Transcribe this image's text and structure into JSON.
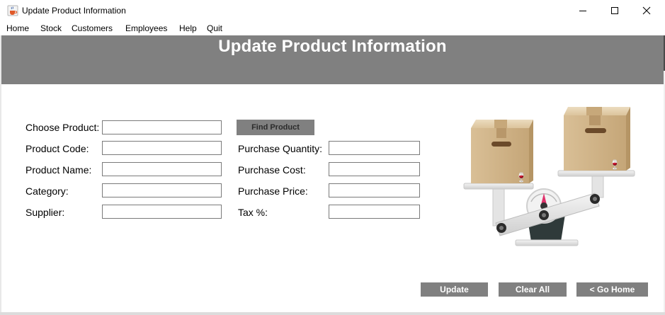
{
  "window": {
    "title": "Update Product Information",
    "controls": {
      "minimize": "minimize",
      "maximize": "maximize",
      "close": "close"
    }
  },
  "menu": {
    "items": [
      "Home",
      "Stock",
      "Customers",
      "Employees",
      "Help",
      "Quit"
    ]
  },
  "header": {
    "title": "Update Product Information"
  },
  "form": {
    "left": [
      {
        "label": "Choose Product:",
        "value": ""
      },
      {
        "label": "Product Code:",
        "value": ""
      },
      {
        "label": "Product Name:",
        "value": ""
      },
      {
        "label": "Category:",
        "value": ""
      },
      {
        "label": "Supplier:",
        "value": ""
      }
    ],
    "right": [
      {
        "label": "Purchase Quantity:",
        "value": ""
      },
      {
        "label": "Purchase Cost:",
        "value": ""
      },
      {
        "label": "Purchase Price:",
        "value": ""
      },
      {
        "label": "Tax %:",
        "value": ""
      }
    ],
    "find_button": "Find Product"
  },
  "actions": {
    "update": "Update",
    "clear_all": "Clear All",
    "go_home": "< Go Home"
  },
  "colors": {
    "header_band": "#808080",
    "button_bg": "#808080",
    "button_text": "#ffffff",
    "field_border": "#7a7a7a"
  },
  "icons": {
    "app": "java-cup-icon",
    "illustration": "boxes-on-scale-illustration"
  }
}
